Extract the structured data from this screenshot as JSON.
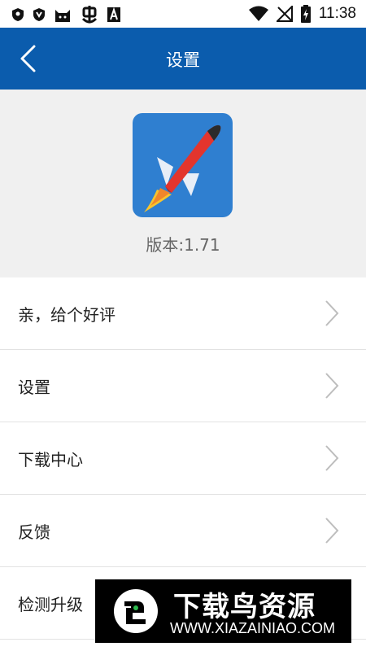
{
  "status_bar": {
    "time": "11:38",
    "icons": [
      "shield-icon",
      "shield-icon",
      "cat-icon",
      "bug-icon",
      "a-icon",
      "wifi-icon",
      "no-signal-icon",
      "battery-charging-icon"
    ]
  },
  "nav": {
    "title": "设置",
    "back_icon": "back-chevron-icon",
    "bg_color": "#0b5cad"
  },
  "app": {
    "icon": "rocket-icon",
    "version": "版本:1.71"
  },
  "menu": {
    "items": [
      {
        "label": "亲，给个好评"
      },
      {
        "label": "设置"
      },
      {
        "label": "下载中心"
      },
      {
        "label": "反馈"
      },
      {
        "label": "检测升级"
      }
    ]
  },
  "watermark": {
    "title": "下载鸟资源",
    "url": "WWW.XIAZAINIAO.COM"
  }
}
